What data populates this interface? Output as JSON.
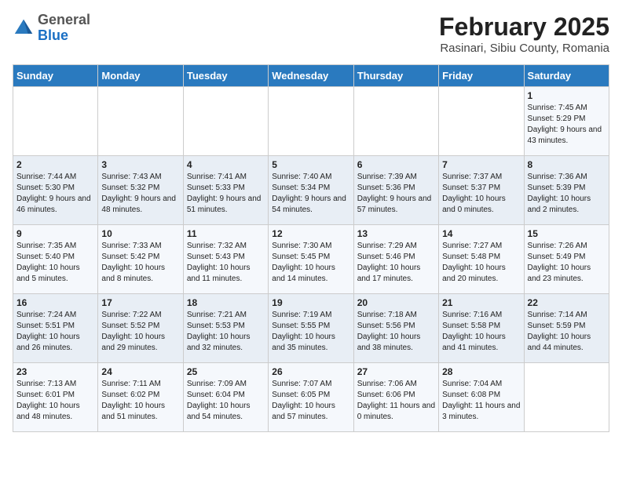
{
  "header": {
    "logo_general": "General",
    "logo_blue": "Blue",
    "month_title": "February 2025",
    "location": "Rasinari, Sibiu County, Romania"
  },
  "days_of_week": [
    "Sunday",
    "Monday",
    "Tuesday",
    "Wednesday",
    "Thursday",
    "Friday",
    "Saturday"
  ],
  "weeks": [
    [
      {
        "day": "",
        "info": ""
      },
      {
        "day": "",
        "info": ""
      },
      {
        "day": "",
        "info": ""
      },
      {
        "day": "",
        "info": ""
      },
      {
        "day": "",
        "info": ""
      },
      {
        "day": "",
        "info": ""
      },
      {
        "day": "1",
        "info": "Sunrise: 7:45 AM\nSunset: 5:29 PM\nDaylight: 9 hours and 43 minutes."
      }
    ],
    [
      {
        "day": "2",
        "info": "Sunrise: 7:44 AM\nSunset: 5:30 PM\nDaylight: 9 hours and 46 minutes."
      },
      {
        "day": "3",
        "info": "Sunrise: 7:43 AM\nSunset: 5:32 PM\nDaylight: 9 hours and 48 minutes."
      },
      {
        "day": "4",
        "info": "Sunrise: 7:41 AM\nSunset: 5:33 PM\nDaylight: 9 hours and 51 minutes."
      },
      {
        "day": "5",
        "info": "Sunrise: 7:40 AM\nSunset: 5:34 PM\nDaylight: 9 hours and 54 minutes."
      },
      {
        "day": "6",
        "info": "Sunrise: 7:39 AM\nSunset: 5:36 PM\nDaylight: 9 hours and 57 minutes."
      },
      {
        "day": "7",
        "info": "Sunrise: 7:37 AM\nSunset: 5:37 PM\nDaylight: 10 hours and 0 minutes."
      },
      {
        "day": "8",
        "info": "Sunrise: 7:36 AM\nSunset: 5:39 PM\nDaylight: 10 hours and 2 minutes."
      }
    ],
    [
      {
        "day": "9",
        "info": "Sunrise: 7:35 AM\nSunset: 5:40 PM\nDaylight: 10 hours and 5 minutes."
      },
      {
        "day": "10",
        "info": "Sunrise: 7:33 AM\nSunset: 5:42 PM\nDaylight: 10 hours and 8 minutes."
      },
      {
        "day": "11",
        "info": "Sunrise: 7:32 AM\nSunset: 5:43 PM\nDaylight: 10 hours and 11 minutes."
      },
      {
        "day": "12",
        "info": "Sunrise: 7:30 AM\nSunset: 5:45 PM\nDaylight: 10 hours and 14 minutes."
      },
      {
        "day": "13",
        "info": "Sunrise: 7:29 AM\nSunset: 5:46 PM\nDaylight: 10 hours and 17 minutes."
      },
      {
        "day": "14",
        "info": "Sunrise: 7:27 AM\nSunset: 5:48 PM\nDaylight: 10 hours and 20 minutes."
      },
      {
        "day": "15",
        "info": "Sunrise: 7:26 AM\nSunset: 5:49 PM\nDaylight: 10 hours and 23 minutes."
      }
    ],
    [
      {
        "day": "16",
        "info": "Sunrise: 7:24 AM\nSunset: 5:51 PM\nDaylight: 10 hours and 26 minutes."
      },
      {
        "day": "17",
        "info": "Sunrise: 7:22 AM\nSunset: 5:52 PM\nDaylight: 10 hours and 29 minutes."
      },
      {
        "day": "18",
        "info": "Sunrise: 7:21 AM\nSunset: 5:53 PM\nDaylight: 10 hours and 32 minutes."
      },
      {
        "day": "19",
        "info": "Sunrise: 7:19 AM\nSunset: 5:55 PM\nDaylight: 10 hours and 35 minutes."
      },
      {
        "day": "20",
        "info": "Sunrise: 7:18 AM\nSunset: 5:56 PM\nDaylight: 10 hours and 38 minutes."
      },
      {
        "day": "21",
        "info": "Sunrise: 7:16 AM\nSunset: 5:58 PM\nDaylight: 10 hours and 41 minutes."
      },
      {
        "day": "22",
        "info": "Sunrise: 7:14 AM\nSunset: 5:59 PM\nDaylight: 10 hours and 44 minutes."
      }
    ],
    [
      {
        "day": "23",
        "info": "Sunrise: 7:13 AM\nSunset: 6:01 PM\nDaylight: 10 hours and 48 minutes."
      },
      {
        "day": "24",
        "info": "Sunrise: 7:11 AM\nSunset: 6:02 PM\nDaylight: 10 hours and 51 minutes."
      },
      {
        "day": "25",
        "info": "Sunrise: 7:09 AM\nSunset: 6:04 PM\nDaylight: 10 hours and 54 minutes."
      },
      {
        "day": "26",
        "info": "Sunrise: 7:07 AM\nSunset: 6:05 PM\nDaylight: 10 hours and 57 minutes."
      },
      {
        "day": "27",
        "info": "Sunrise: 7:06 AM\nSunset: 6:06 PM\nDaylight: 11 hours and 0 minutes."
      },
      {
        "day": "28",
        "info": "Sunrise: 7:04 AM\nSunset: 6:08 PM\nDaylight: 11 hours and 3 minutes."
      },
      {
        "day": "",
        "info": ""
      }
    ]
  ]
}
